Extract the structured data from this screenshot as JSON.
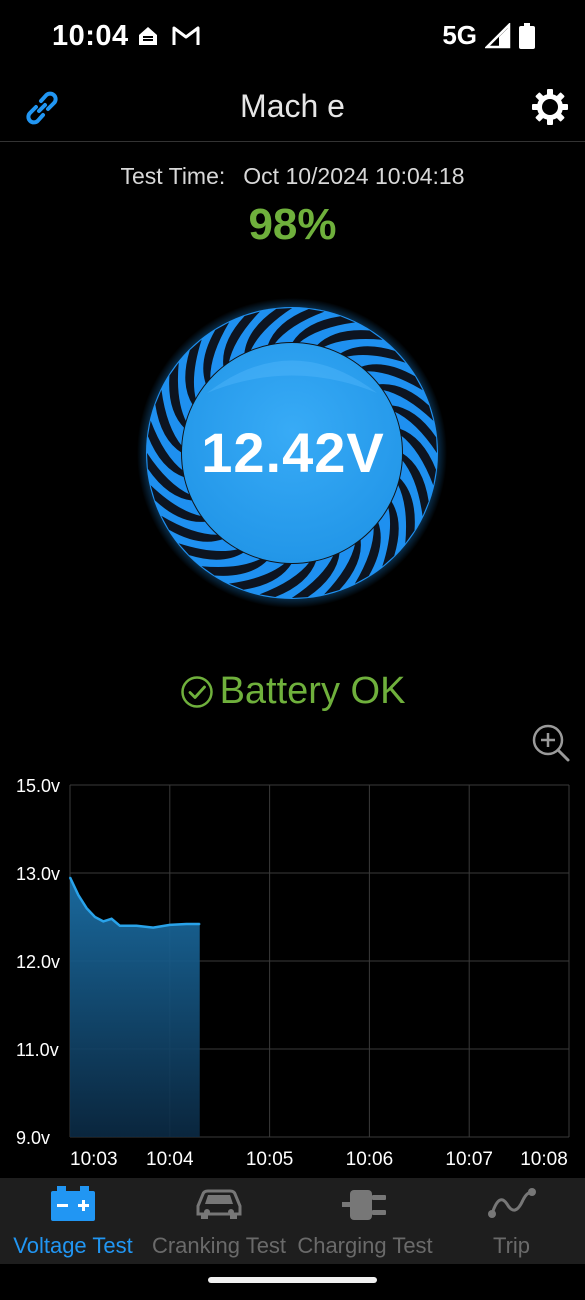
{
  "status_bar": {
    "time": "10:04",
    "network": "5G",
    "icons_left": [
      "home-notification-icon",
      "gmail-icon"
    ],
    "icons_right": [
      "signal-icon",
      "battery-icon"
    ]
  },
  "header": {
    "title": "Mach e",
    "link_icon": "link-icon",
    "settings_icon": "gear-icon",
    "accent_color": "#2196f3"
  },
  "test": {
    "time_label": "Test Time:",
    "time_value": "Oct 10/2024 10:04:18",
    "percent": "98%",
    "percent_color": "#6fb03c"
  },
  "gauge": {
    "voltage": "12.42V"
  },
  "battery_status": {
    "text": "Battery OK",
    "color": "#6fb03c"
  },
  "zoom": {
    "icon": "zoom-in-icon"
  },
  "chart_data": {
    "type": "area",
    "title": "",
    "xlabel": "",
    "ylabel": "",
    "y_tick_labels": [
      "15.0v",
      "13.0v",
      "12.0v",
      "11.0v",
      "9.0v"
    ],
    "x_tick_labels": [
      "10:03",
      "10:04",
      "10:05",
      "10:06",
      "10:07",
      "10:08"
    ],
    "grid": true,
    "series": [
      {
        "color": "#29a3ea",
        "points": [
          [
            "10:03:00",
            12.95
          ],
          [
            "10:03:05",
            12.75
          ],
          [
            "10:03:10",
            12.6
          ],
          [
            "10:03:15",
            12.5
          ],
          [
            "10:03:20",
            12.45
          ],
          [
            "10:03:25",
            12.48
          ],
          [
            "10:03:30",
            12.4
          ],
          [
            "10:03:40",
            12.4
          ],
          [
            "10:03:50",
            12.38
          ],
          [
            "10:04:00",
            12.41
          ],
          [
            "10:04:10",
            12.42
          ],
          [
            "10:04:18",
            12.42
          ]
        ]
      }
    ]
  },
  "bottom_nav": {
    "items": [
      {
        "label": "Voltage Test",
        "icon": "car-battery-icon",
        "active": true
      },
      {
        "label": "Cranking Test",
        "icon": "car-icon",
        "active": false
      },
      {
        "label": "Charging Test",
        "icon": "plug-icon",
        "active": false
      },
      {
        "label": "Trip",
        "icon": "route-icon",
        "active": false
      }
    ]
  }
}
